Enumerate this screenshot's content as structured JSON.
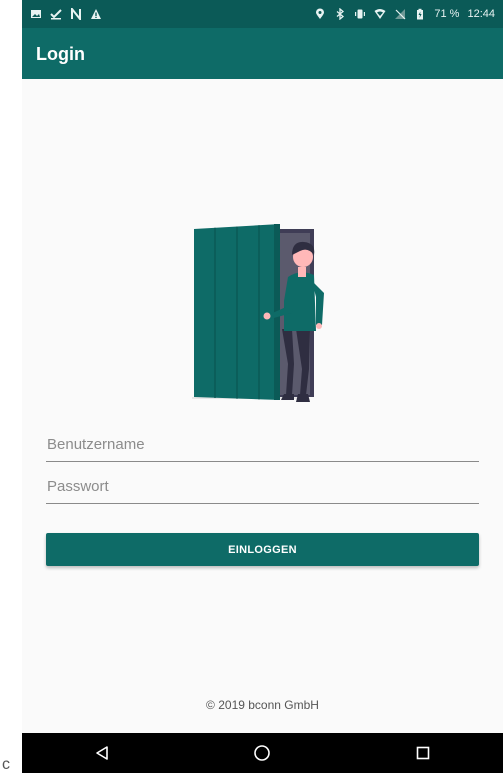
{
  "status_bar": {
    "battery": "71 %",
    "time": "12:44",
    "left_icons": [
      "image-icon",
      "download-check-icon",
      "n-icon",
      "warning-icon"
    ],
    "right_icons": [
      "location-icon",
      "bluetooth-icon",
      "vibrate-icon",
      "wifi-icon",
      "no-signal-icon",
      "battery-icon"
    ]
  },
  "appbar": {
    "title": "Login"
  },
  "form": {
    "username_placeholder": "Benutzername",
    "password_placeholder": "Passwort",
    "login_label": "EINLOGGEN"
  },
  "footer": {
    "copyright": "© 2019 bconn GmbH"
  },
  "stray_text": "c",
  "colors": {
    "primary": "#0e6b67",
    "primary_dark": "#0b5a57",
    "background": "#fafafa"
  }
}
